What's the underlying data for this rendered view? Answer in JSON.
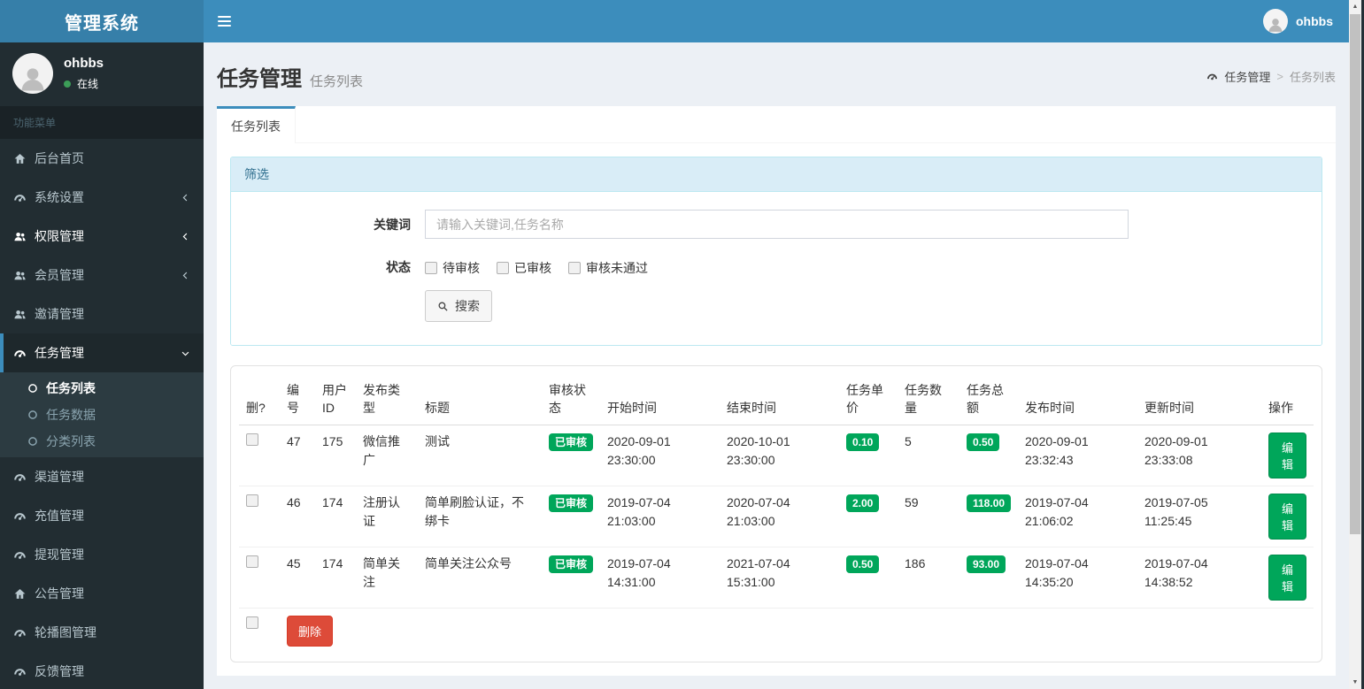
{
  "colors": {
    "navbar_blue": "#3c8dbc",
    "logo_blue": "#367fa9",
    "sidebar_dark": "#222d32",
    "submenu_dark": "#2c3b41",
    "badge_green": "#00a65a",
    "delete_red": "#dd4b39",
    "panel_heading_bg": "#d9edf7",
    "body_bg": "#ecf0f5"
  },
  "app": {
    "logo": "管理系统"
  },
  "topbar": {
    "username": "ohbbs"
  },
  "sidebar": {
    "user_name": "ohbbs",
    "user_status": "在线",
    "section_label": "功能菜单",
    "items": [
      {
        "label": "后台首页",
        "icon": "home-icon"
      },
      {
        "label": "系统设置",
        "icon": "tachometer-icon",
        "chevron": "left"
      },
      {
        "label": "权限管理",
        "icon": "users-icon",
        "chevron": "left"
      },
      {
        "label": "会员管理",
        "icon": "users-icon",
        "chevron": "left"
      },
      {
        "label": "邀请管理",
        "icon": "users-icon"
      },
      {
        "label": "任务管理",
        "icon": "tachometer-icon",
        "chevron": "down",
        "active": true
      },
      {
        "label": "渠道管理",
        "icon": "tachometer-icon"
      },
      {
        "label": "充值管理",
        "icon": "tachometer-icon"
      },
      {
        "label": "提现管理",
        "icon": "tachometer-icon"
      },
      {
        "label": "公告管理",
        "icon": "home-icon"
      },
      {
        "label": "轮播图管理",
        "icon": "tachometer-icon"
      },
      {
        "label": "反馈管理",
        "icon": "tachometer-icon"
      }
    ],
    "submenu": [
      {
        "label": "任务列表",
        "active": true
      },
      {
        "label": "任务数据"
      },
      {
        "label": "分类列表"
      }
    ]
  },
  "page": {
    "title": "任务管理",
    "subtitle": "任务列表",
    "breadcrumb_root": "任务管理",
    "breadcrumb_sep": ">",
    "breadcrumb_current": "任务列表",
    "tab_label": "任务列表"
  },
  "filter": {
    "panel_title": "筛选",
    "keyword_label": "关键词",
    "keyword_placeholder": "请输入关键词,任务名称",
    "keyword_value": "",
    "status_label": "状态",
    "status_options": [
      {
        "label": "待审核",
        "checked": false
      },
      {
        "label": "已审核",
        "checked": false
      },
      {
        "label": "审核未通过",
        "checked": false
      }
    ],
    "search_label": "搜索"
  },
  "table": {
    "headers": [
      "删?",
      "编号",
      "用户ID",
      "发布类型",
      "标题",
      "审核状态",
      "开始时间",
      "结束时间",
      "任务单价",
      "任务数量",
      "任务总额",
      "发布时间",
      "更新时间",
      "操作"
    ],
    "rows": [
      {
        "id": "47",
        "user_id": "175",
        "type": "微信推广",
        "title": "测试",
        "status": "已审核",
        "start_time": "2020-09-01 23:30:00",
        "end_time": "2020-10-01 23:30:00",
        "unit_price": "0.10",
        "quantity": "5",
        "total": "0.50",
        "publish_time": "2020-09-01 23:32:43",
        "update_time": "2020-09-01 23:33:08",
        "action": "编辑"
      },
      {
        "id": "46",
        "user_id": "174",
        "type": "注册认证",
        "title": "简单刷脸认证，不绑卡",
        "status": "已审核",
        "start_time": "2019-07-04 21:03:00",
        "end_time": "2020-07-04 21:03:00",
        "unit_price": "2.00",
        "quantity": "59",
        "total": "118.00",
        "publish_time": "2019-07-04 21:06:02",
        "update_time": "2019-07-05 11:25:45",
        "action": "编辑"
      },
      {
        "id": "45",
        "user_id": "174",
        "type": "简单关注",
        "title": "简单关注公众号",
        "status": "已审核",
        "start_time": "2019-07-04 14:31:00",
        "end_time": "2021-07-04 15:31:00",
        "unit_price": "0.50",
        "quantity": "186",
        "total": "93.00",
        "publish_time": "2019-07-04 14:35:20",
        "update_time": "2019-07-04 14:38:52",
        "action": "编辑"
      }
    ],
    "delete_label": "删除"
  }
}
